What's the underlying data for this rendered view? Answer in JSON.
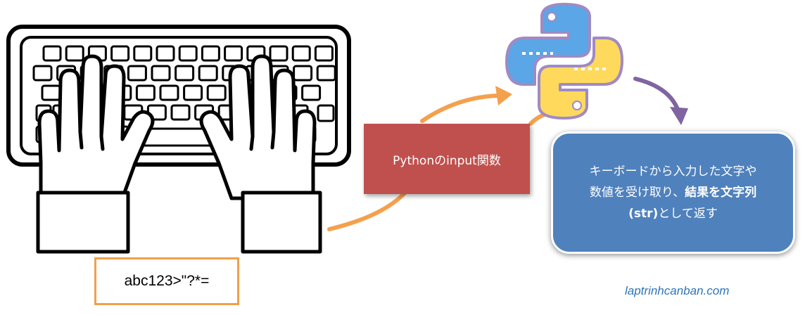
{
  "input_example": {
    "text": "abc123>\"?*="
  },
  "function_label": {
    "text": "Pythonのinput関数"
  },
  "result": {
    "line1": "キーボードから入力した文字や",
    "line2_plain": "数値を受け取り、",
    "line2_bold": "結果を文字列",
    "line3_bold": "(str)",
    "line3_plain": "として返す"
  },
  "credit": {
    "text": "laptrinhcanban.com"
  },
  "icons": {
    "keyboard": "keyboard-with-hands-icon",
    "python": "python-logo-icon"
  },
  "colors": {
    "input_border": "#f0a04b",
    "orange_arrow": "#f4a04d",
    "function_box": "#c0504d",
    "purple_arrow": "#8064a2",
    "result_box": "#4f81bd",
    "python_blue": "#5aa6e6",
    "python_yellow": "#ffd95c",
    "credit_text": "#2e75b6"
  }
}
